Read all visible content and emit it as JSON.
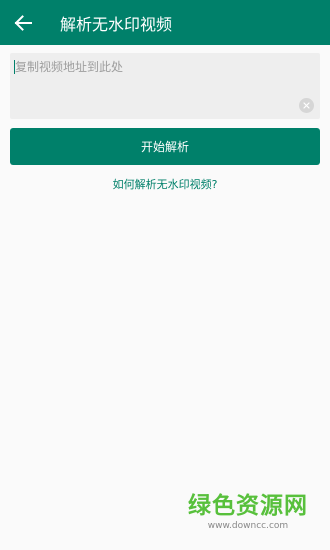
{
  "appbar": {
    "back_icon": "arrow-left-icon",
    "title": "解析无水印视频"
  },
  "input": {
    "placeholder": "复制视频地址到此处",
    "value": "",
    "clear_icon": "close-icon"
  },
  "actions": {
    "parse_label": "开始解析"
  },
  "help": {
    "link_text": "如何解析无水印视频?"
  },
  "watermark": {
    "logo_text": "绿色资源网",
    "url": "www.downcc.com"
  },
  "colors": {
    "primary": "#00806a",
    "background": "#fafafa",
    "input_bg": "#eeeeee",
    "watermark_green": "#58c03c"
  }
}
